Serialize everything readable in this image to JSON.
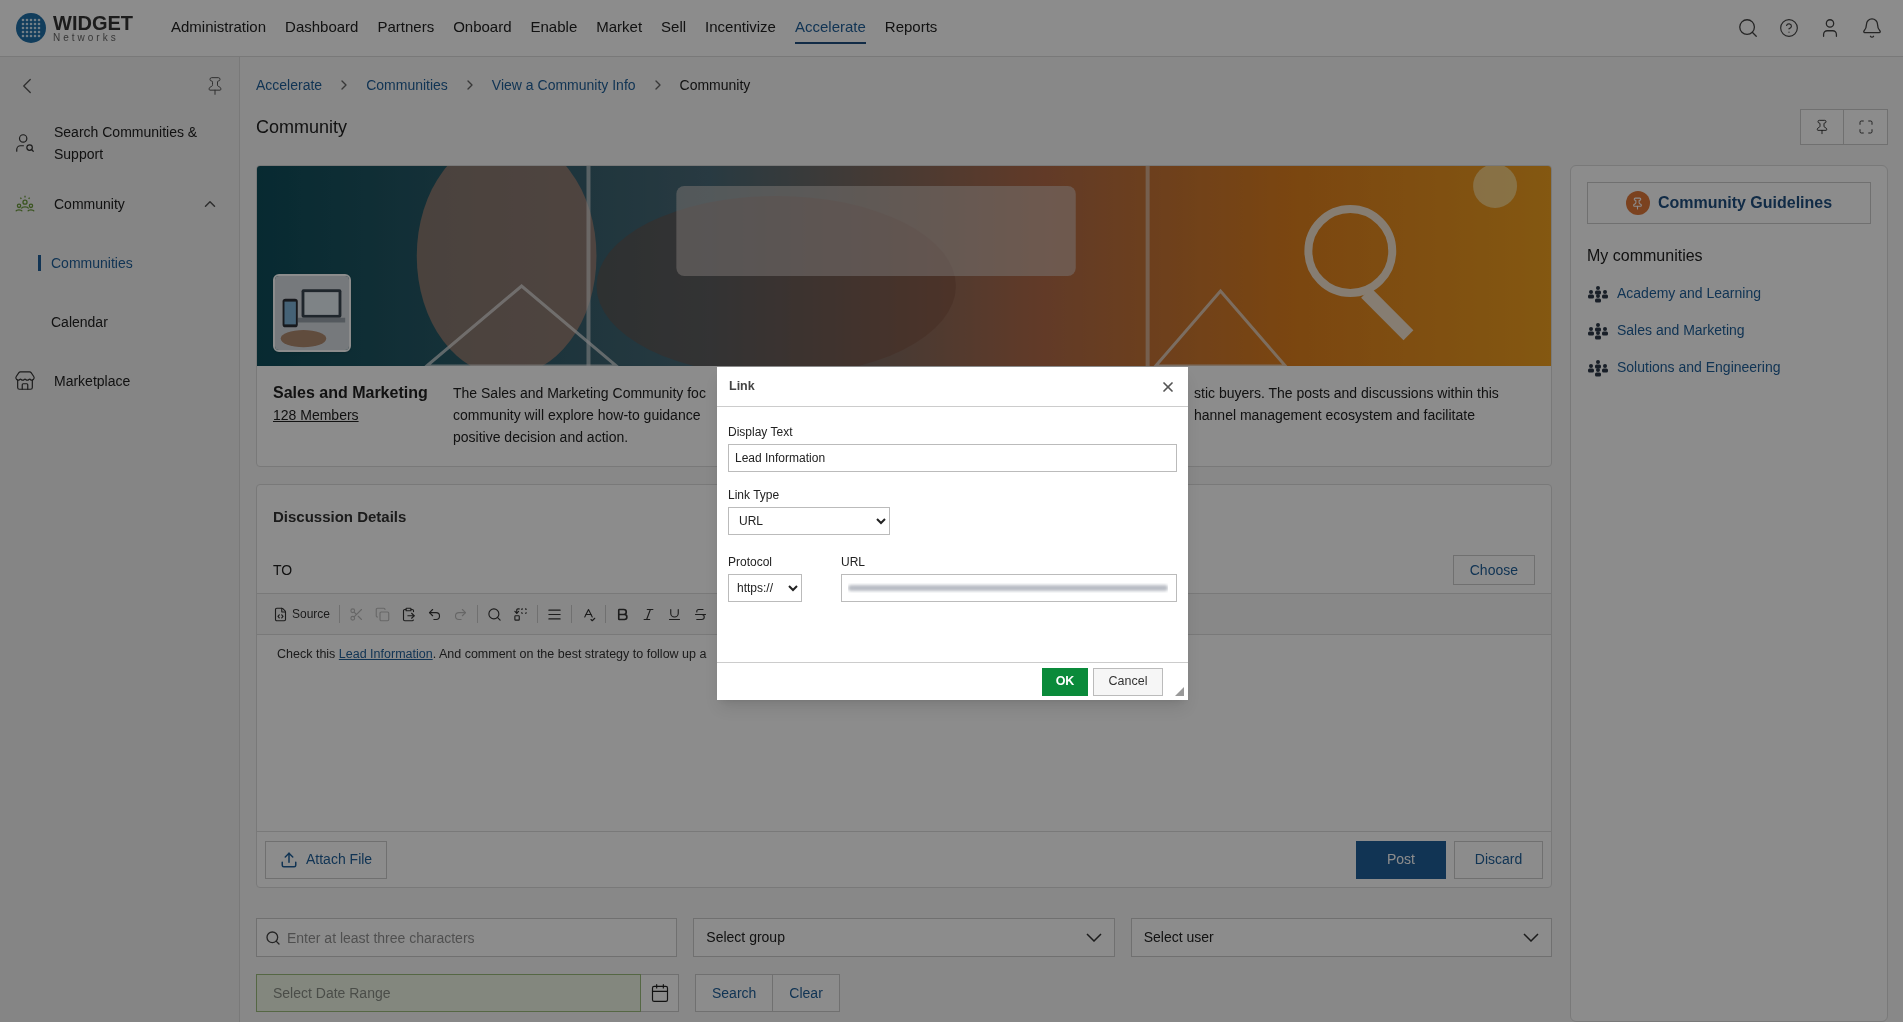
{
  "brand": {
    "name": "WIDGET",
    "tagline": "Networks"
  },
  "nav": [
    {
      "label": "Administration",
      "selected": false
    },
    {
      "label": "Dashboard",
      "selected": false
    },
    {
      "label": "Partners",
      "selected": false
    },
    {
      "label": "Onboard",
      "selected": false
    },
    {
      "label": "Enable",
      "selected": false
    },
    {
      "label": "Market",
      "selected": false
    },
    {
      "label": "Sell",
      "selected": false
    },
    {
      "label": "Incentivize",
      "selected": false
    },
    {
      "label": "Accelerate",
      "selected": true
    },
    {
      "label": "Reports",
      "selected": false
    }
  ],
  "sidebar": {
    "items": [
      {
        "label": "Search Communities & Support",
        "kind": "search"
      },
      {
        "label": "Community",
        "kind": "community",
        "expanded": true,
        "children": [
          {
            "label": "Communities",
            "selected": true
          },
          {
            "label": "Calendar",
            "selected": false
          }
        ]
      },
      {
        "label": "Marketplace",
        "kind": "marketplace"
      }
    ]
  },
  "breadcrumb": [
    "Accelerate",
    "Communities",
    "View a Community Info",
    "Community"
  ],
  "page_title": "Community",
  "community": {
    "name": "Sales and Marketing",
    "members": "128 Members",
    "description_left": [
      "The Sales and Marketing Community foc",
      "community will explore how-to guidance",
      "positive decision and action."
    ],
    "description_right": [
      "stic buyers. The posts and discussions within this",
      "hannel management ecosystem and facilitate"
    ]
  },
  "discussion": {
    "title": "Discussion Details",
    "to_label": "TO",
    "choose": "Choose",
    "toolbar": [
      {
        "kind": "source",
        "label": "Source",
        "disabled": false
      },
      {
        "kind": "separator"
      },
      {
        "kind": "cut",
        "disabled": true
      },
      {
        "kind": "copy",
        "disabled": true
      },
      {
        "kind": "paste",
        "disabled": false
      },
      {
        "kind": "undo",
        "disabled": false
      },
      {
        "kind": "redo",
        "disabled": true
      },
      {
        "kind": "separator"
      },
      {
        "kind": "find",
        "disabled": false
      },
      {
        "kind": "replace",
        "disabled": false
      },
      {
        "kind": "separator"
      },
      {
        "kind": "block",
        "disabled": false
      },
      {
        "kind": "separator"
      },
      {
        "kind": "spell",
        "disabled": false
      },
      {
        "kind": "separator"
      },
      {
        "kind": "bold",
        "disabled": false
      },
      {
        "kind": "italic",
        "disabled": false
      },
      {
        "kind": "underline",
        "disabled": false
      },
      {
        "kind": "strike"
      }
    ],
    "body_before": "Check this ",
    "link": "Lead Information",
    "body_after": ". And comment on the best strategy to follow up a",
    "attach": "Attach File",
    "post": "Post",
    "discard": "Discard"
  },
  "filters": {
    "search_placeholder": "Enter at least three characters",
    "group_placeholder": "Select group",
    "user_placeholder": "Select user",
    "date_placeholder": "Select Date Range",
    "search": "Search",
    "clear": "Clear"
  },
  "right_panel": {
    "guidelines": "Community Guidelines",
    "my_title": "My communities",
    "communities": [
      "Academy and Learning",
      "Sales and Marketing",
      "Solutions and Engineering"
    ]
  },
  "dialog": {
    "title": "Link",
    "display_label": "Display Text",
    "display_value": "Lead Information",
    "type_label": "Link Type",
    "type_value": "URL",
    "protocol_label": "Protocol",
    "protocol_value": "https://",
    "url_label": "URL",
    "ok": "OK",
    "cancel": "Cancel"
  }
}
